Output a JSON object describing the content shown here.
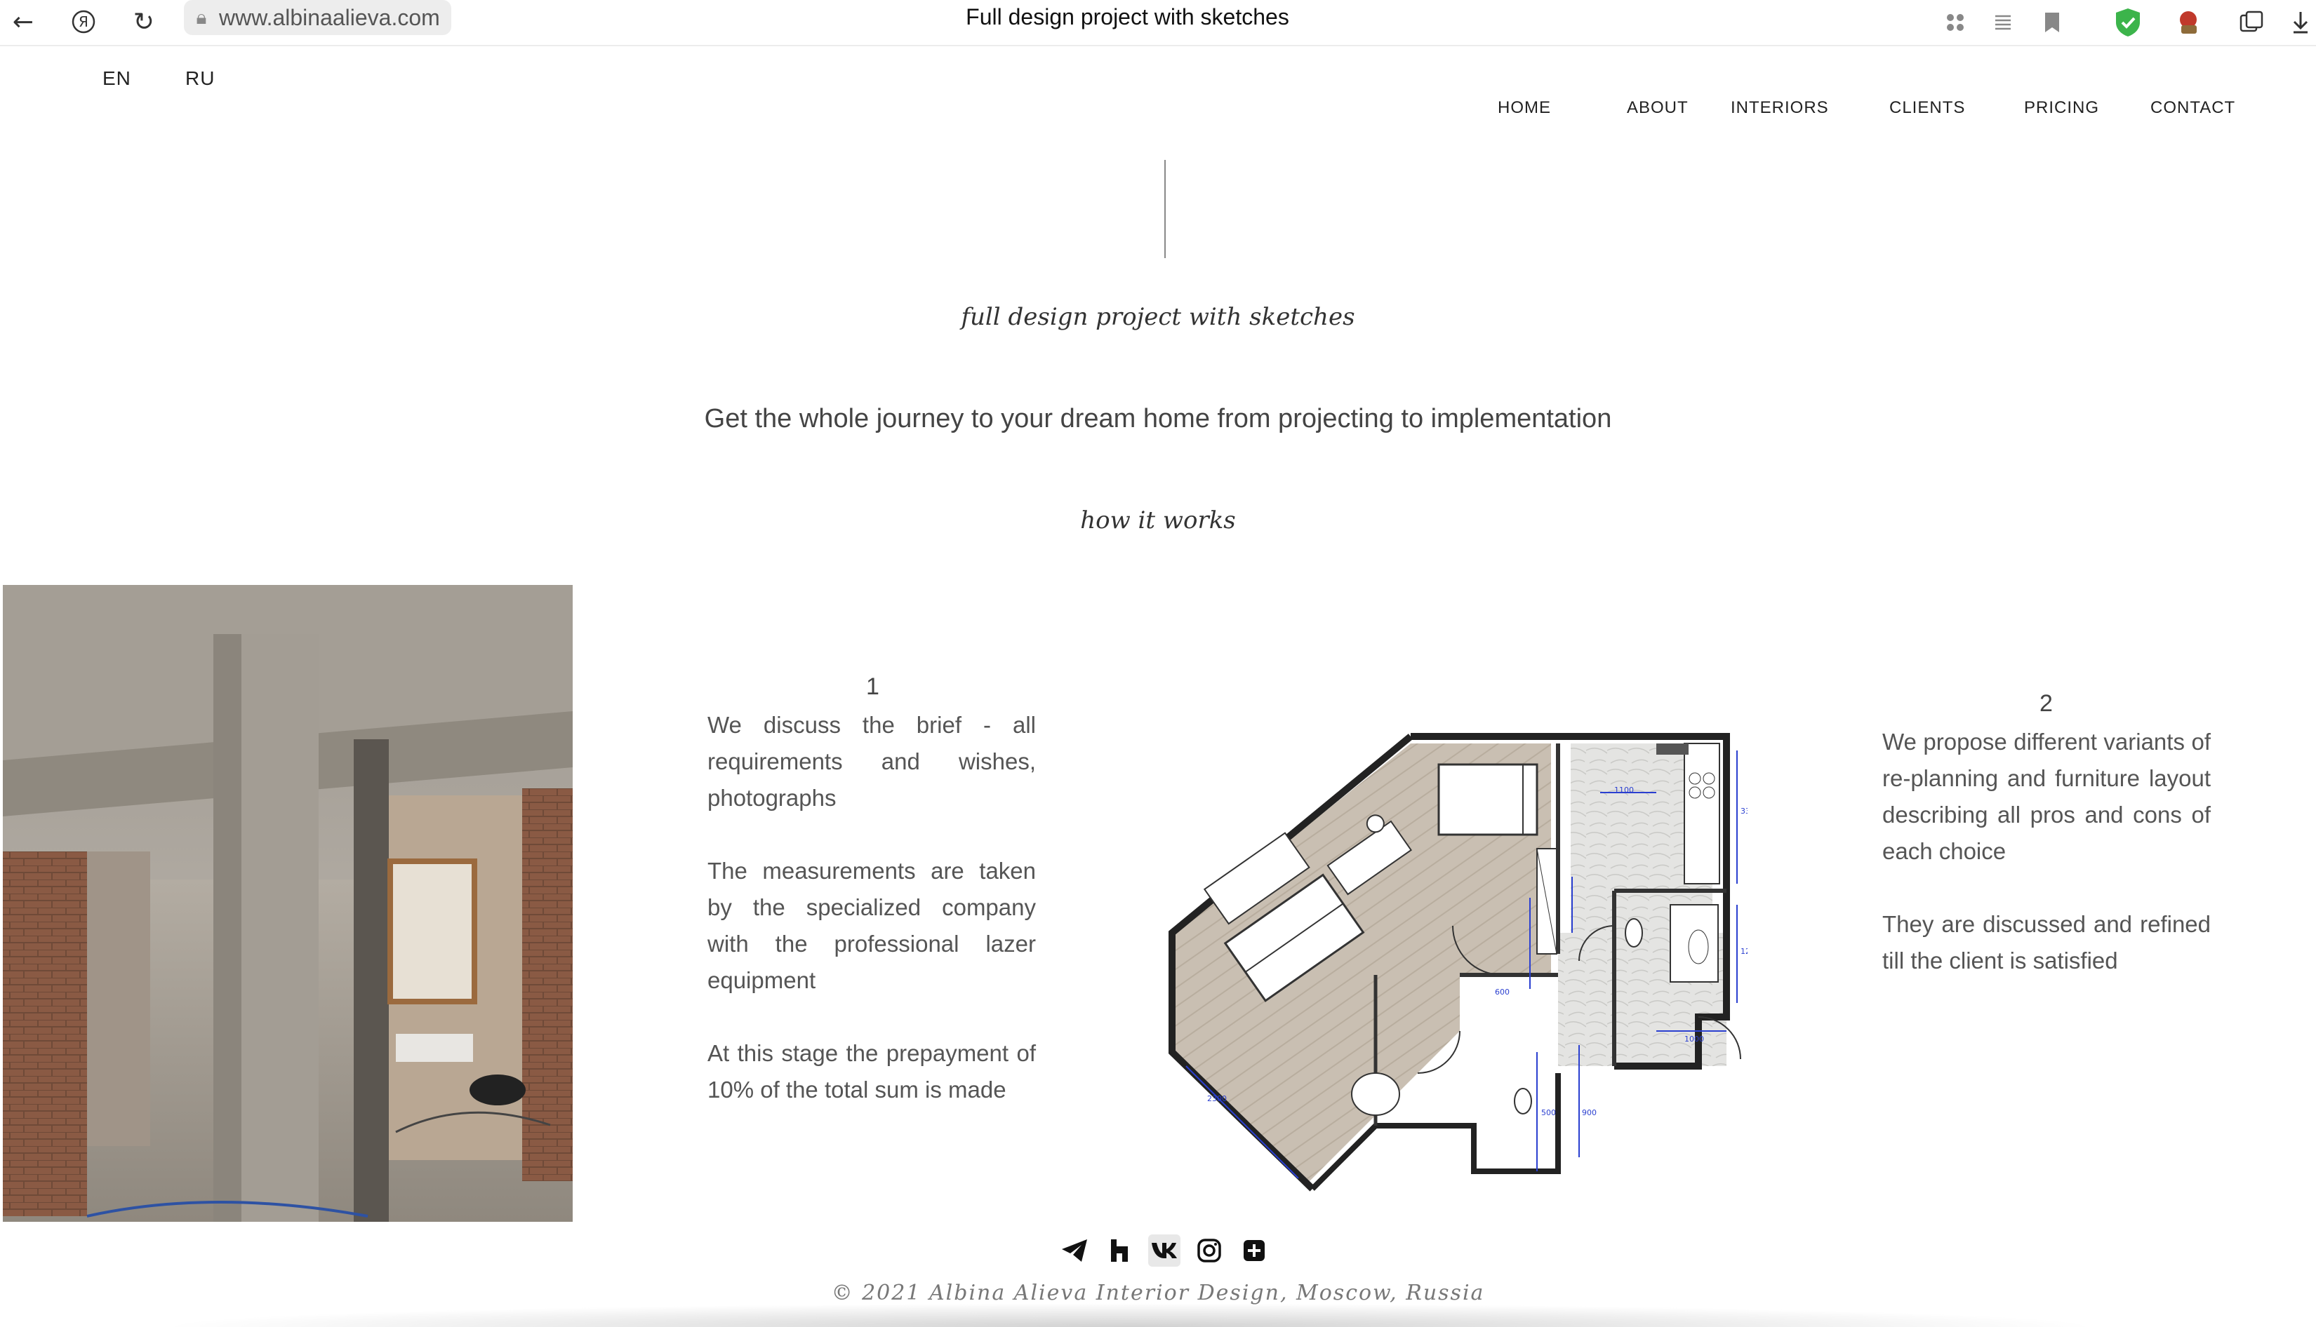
{
  "browser": {
    "url": "www.albinaalieva.com",
    "title": "Full design project with sketches"
  },
  "header": {
    "languages": [
      "EN",
      "RU"
    ],
    "nav": [
      "HOME",
      "ABOUT",
      "INTERIORS",
      "CLIENTS",
      "PRICING",
      "CONTACT"
    ]
  },
  "hero": {
    "title": "full design project with sketches",
    "subtitle": "Get the whole journey to your dream home from projecting to implementation",
    "how": "how it works"
  },
  "steps": [
    {
      "number": "1",
      "paragraphs": [
        "We discuss the brief - all requirements and wishes, photographs",
        "The measurements are taken by the specialized company with the professional lazer equipment",
        "At this stage the prepayment of 10% of the total sum is made"
      ]
    },
    {
      "number": "2",
      "paragraphs": [
        "We propose different variants of re-planning and furniture layout describing all pros and cons of each choice",
        "They are discussed and refined till the client is satisfied"
      ]
    }
  ],
  "footer": {
    "copyright": "© 2021 Albina Alieva Interior Design, Moscow, Russia",
    "socials": [
      "telegram-icon",
      "houzz-icon",
      "vk-icon",
      "instagram-icon",
      "plus-square-icon"
    ]
  },
  "colors": {
    "accent": "#1a1a1a",
    "plan_floor": "#c9bfb2",
    "plan_dimensions": "#2a3fd0",
    "shield_green": "#3cb44b"
  }
}
